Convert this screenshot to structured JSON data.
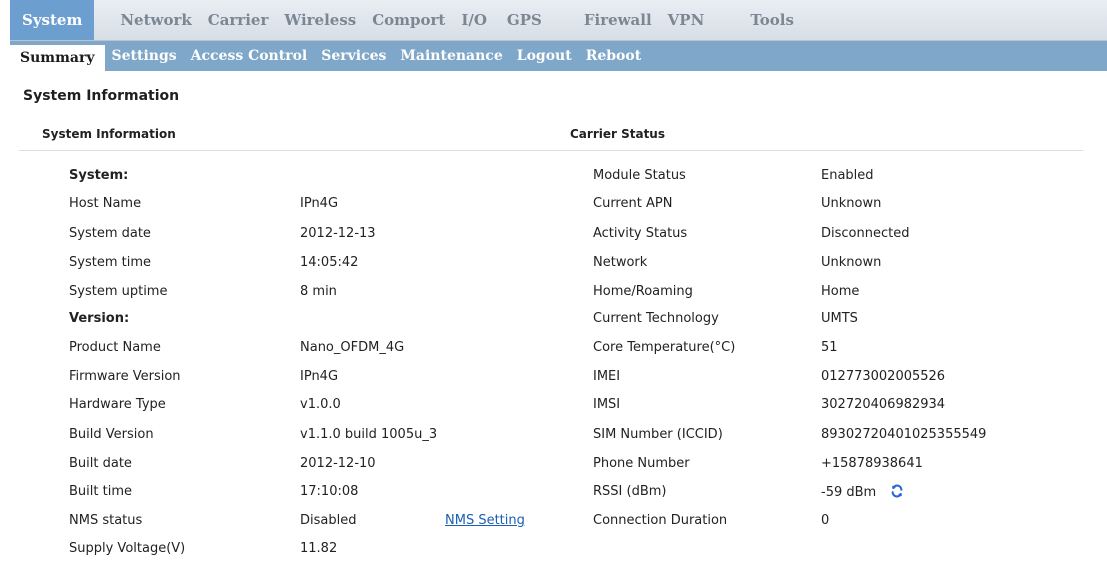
{
  "topnav": {
    "items": [
      "System",
      "Network",
      "Carrier",
      "Wireless",
      "Comport",
      "I/O",
      "GPS",
      "Firewall",
      "VPN",
      "Tools"
    ]
  },
  "subnav": {
    "items": [
      "Summary",
      "Settings",
      "Access Control",
      "Services",
      "Maintenance",
      "Logout",
      "Reboot"
    ]
  },
  "page": {
    "title": "System Information",
    "left_section": "System Information",
    "right_section": "Carrier Status"
  },
  "system_info": {
    "system_heading": "System:",
    "rows1": [
      {
        "label": "Host Name",
        "value": "IPn4G"
      },
      {
        "label": "System date",
        "value": "2012-12-13"
      },
      {
        "label": "System time",
        "value": "14:05:42"
      },
      {
        "label": "System uptime",
        "value": "8 min"
      }
    ],
    "version_heading": "Version:",
    "rows2": [
      {
        "label": "Product Name",
        "value": "Nano_OFDM_4G"
      },
      {
        "label": "Firmware Version",
        "value": "IPn4G"
      },
      {
        "label": "Hardware Type",
        "value": "v1.0.0"
      },
      {
        "label": "Build Version",
        "value": "v1.1.0 build 1005u_3"
      },
      {
        "label": "Built date",
        "value": "2012-12-10"
      },
      {
        "label": "Built time",
        "value": "17:10:08"
      },
      {
        "label": "NMS status",
        "value": "Disabled"
      },
      {
        "label": "Supply Voltage(V)",
        "value": "11.82"
      }
    ],
    "nms_link": "NMS Setting"
  },
  "carrier_status": {
    "rows": [
      {
        "label": "Module Status",
        "value": "Enabled"
      },
      {
        "label": "Current APN",
        "value": "Unknown"
      },
      {
        "label": "Activity Status",
        "value": "Disconnected"
      },
      {
        "label": "Network",
        "value": "Unknown"
      },
      {
        "label": "Home/Roaming",
        "value": "Home"
      },
      {
        "label": "Current Technology",
        "value": "UMTS"
      },
      {
        "label": "Core Temperature(°C)",
        "value": "51"
      },
      {
        "label": "IMEI",
        "value": "012773002005526"
      },
      {
        "label": "IMSI",
        "value": "302720406982934"
      },
      {
        "label": "SIM Number (ICCID)",
        "value": "89302720401025355549"
      },
      {
        "label": "Phone Number",
        "value": "+15878938641"
      },
      {
        "label": "RSSI (dBm)",
        "value": "-59 dBm"
      },
      {
        "label": "Connection Duration",
        "value": "0"
      }
    ]
  },
  "icons": {
    "refresh": "refresh-icon"
  },
  "colors": {
    "active_tab": "#6c9fcf",
    "subnav_bg": "#7fa7c9",
    "link": "#1a5fb4",
    "refresh_icon": "#2a64d6"
  }
}
